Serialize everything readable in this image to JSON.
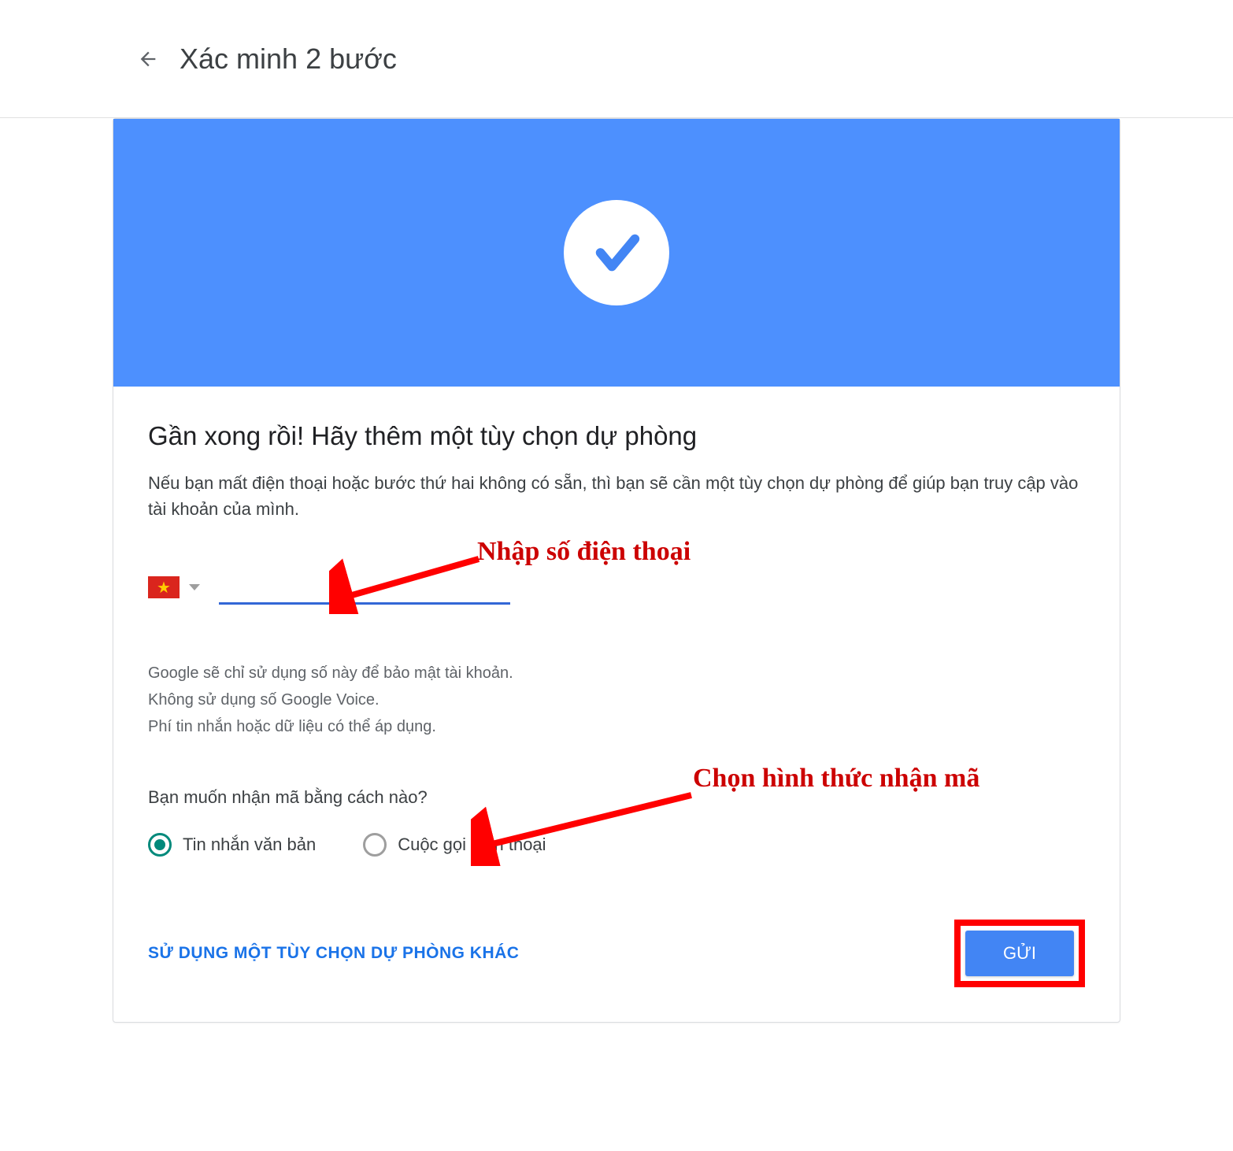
{
  "header": {
    "title": "Xác minh 2 bước"
  },
  "main": {
    "heading": "Gần xong rồi! Hãy thêm một tùy chọn dự phòng",
    "description": "Nếu bạn mất điện thoại hoặc bước thứ hai không có sẵn, thì bạn sẽ cần một tùy chọn dự phòng để giúp bạn truy cập vào tài khoản của mình.",
    "phone": {
      "country": "VN",
      "value": ""
    },
    "notes": {
      "line1": "Google sẽ chỉ sử dụng số này để bảo mật tài khoản.",
      "line2": "Không sử dụng số Google Voice.",
      "line3": "Phí tin nhắn hoặc dữ liệu có thể áp dụng."
    },
    "question": "Bạn muốn nhận mã bằng cách nào?",
    "radio": {
      "option1": "Tin nhắn văn bản",
      "option2": "Cuộc gọi điện thoại",
      "selected": "option1"
    },
    "actions": {
      "alt_link": "SỬ DỤNG MỘT TÙY CHỌN DỰ PHÒNG KHÁC",
      "send": "GỬI"
    }
  },
  "annotations": {
    "phone_hint": "Nhập số điện thoại",
    "method_hint": "Chọn hình thức nhận mã"
  }
}
